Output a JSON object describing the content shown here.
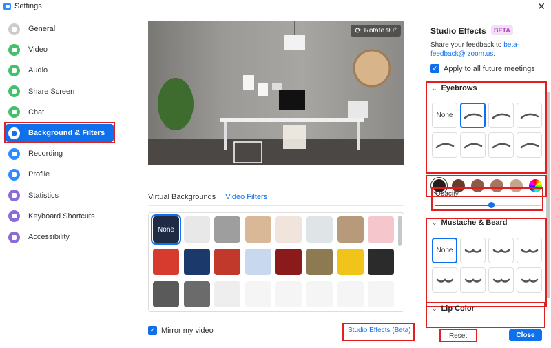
{
  "window": {
    "title": "Settings",
    "close_glyph": "✕"
  },
  "sidebar": {
    "items": [
      {
        "label": "General",
        "icon": "gear-icon",
        "color": "#cccccc"
      },
      {
        "label": "Video",
        "icon": "video-icon",
        "color": "#43c06b"
      },
      {
        "label": "Audio",
        "icon": "headphones-icon",
        "color": "#43c06b"
      },
      {
        "label": "Share Screen",
        "icon": "share-screen-icon",
        "color": "#43c06b"
      },
      {
        "label": "Chat",
        "icon": "chat-icon",
        "color": "#43c06b"
      },
      {
        "label": "Background & Filters",
        "icon": "background-icon",
        "color": "#ffffff",
        "active": true
      },
      {
        "label": "Recording",
        "icon": "recording-icon",
        "color": "#2d8cff"
      },
      {
        "label": "Profile",
        "icon": "profile-icon",
        "color": "#2d8cff"
      },
      {
        "label": "Statistics",
        "icon": "statistics-icon",
        "color": "#8b6bd9"
      },
      {
        "label": "Keyboard Shortcuts",
        "icon": "keyboard-icon",
        "color": "#8b6bd9"
      },
      {
        "label": "Accessibility",
        "icon": "accessibility-icon",
        "color": "#8b6bd9"
      }
    ]
  },
  "preview": {
    "rotate_label": "Rotate 90°",
    "rotate_glyph": "⟳"
  },
  "tabs": {
    "virtual": "Virtual Backgrounds",
    "filters": "Video Filters",
    "active": "filters"
  },
  "filters": {
    "none_label": "None",
    "tiles": [
      {
        "name": "filter-none",
        "bg": "#1f2a44",
        "selected": true
      },
      {
        "name": "filter-light-1",
        "bg": "#e8e8e8"
      },
      {
        "name": "filter-gray",
        "bg": "#9e9e9e"
      },
      {
        "name": "filter-beige",
        "bg": "#d8b896"
      },
      {
        "name": "filter-warm-light",
        "bg": "#f0e4dc"
      },
      {
        "name": "filter-cool-light",
        "bg": "#dfe4e6"
      },
      {
        "name": "filter-tan",
        "bg": "#b79a7a"
      },
      {
        "name": "filter-pink",
        "bg": "#f5c6cc"
      },
      {
        "name": "filter-camera-frame",
        "bg": "#d63b2e"
      },
      {
        "name": "filter-lights",
        "bg": "#1b3a6b"
      },
      {
        "name": "filter-holiday-frame",
        "bg": "#c0392b"
      },
      {
        "name": "filter-stage",
        "bg": "#c8d8ee"
      },
      {
        "name": "filter-theater",
        "bg": "#8b1a1a"
      },
      {
        "name": "filter-tv",
        "bg": "#8c7a52"
      },
      {
        "name": "filter-sunflower",
        "bg": "#f0c419"
      },
      {
        "name": "filter-bulbs",
        "bg": "#2b2b2b"
      },
      {
        "name": "filter-viewfinder",
        "bg": "#5a5a5a"
      },
      {
        "name": "filter-retro-tv",
        "bg": "#6b6b6b"
      },
      {
        "name": "filter-ribbon",
        "bg": "#eeeeee"
      },
      {
        "name": "filter-speech",
        "bg": "#f5f5f5"
      },
      {
        "name": "filter-santa-hat",
        "bg": "#f5f5f5"
      },
      {
        "name": "filter-reindeer",
        "bg": "#f5f5f5"
      },
      {
        "name": "filter-beanie",
        "bg": "#f5f5f5"
      },
      {
        "name": "filter-sunglasses",
        "bg": "#f5f5f5"
      }
    ]
  },
  "mirror": {
    "label": "Mirror my video",
    "checked": true
  },
  "studio_link": "Studio Effects (Beta)",
  "studio": {
    "title": "Studio Effects",
    "beta": "BETA",
    "feedback_text": "Share your feedback to ",
    "feedback_email": "beta-feedback@ zoom.us",
    "feedback_end": ".",
    "apply_label": "Apply to all future meetings",
    "eyebrows": {
      "label": "Eyebrows",
      "none": "None",
      "selected_index": 1
    },
    "swatches": [
      "#2a1d17",
      "#6b3a2a",
      "#8d5a4a",
      "#a87462",
      "#c9a48a",
      "color-wheel"
    ],
    "opacity": {
      "label": "Opacity",
      "value": 0.53
    },
    "mustache": {
      "label": "Mustache & Beard",
      "none": "None",
      "selected_index": 0
    },
    "lip": {
      "label": "Lip Color"
    },
    "reset": "Reset",
    "close": "Close"
  }
}
